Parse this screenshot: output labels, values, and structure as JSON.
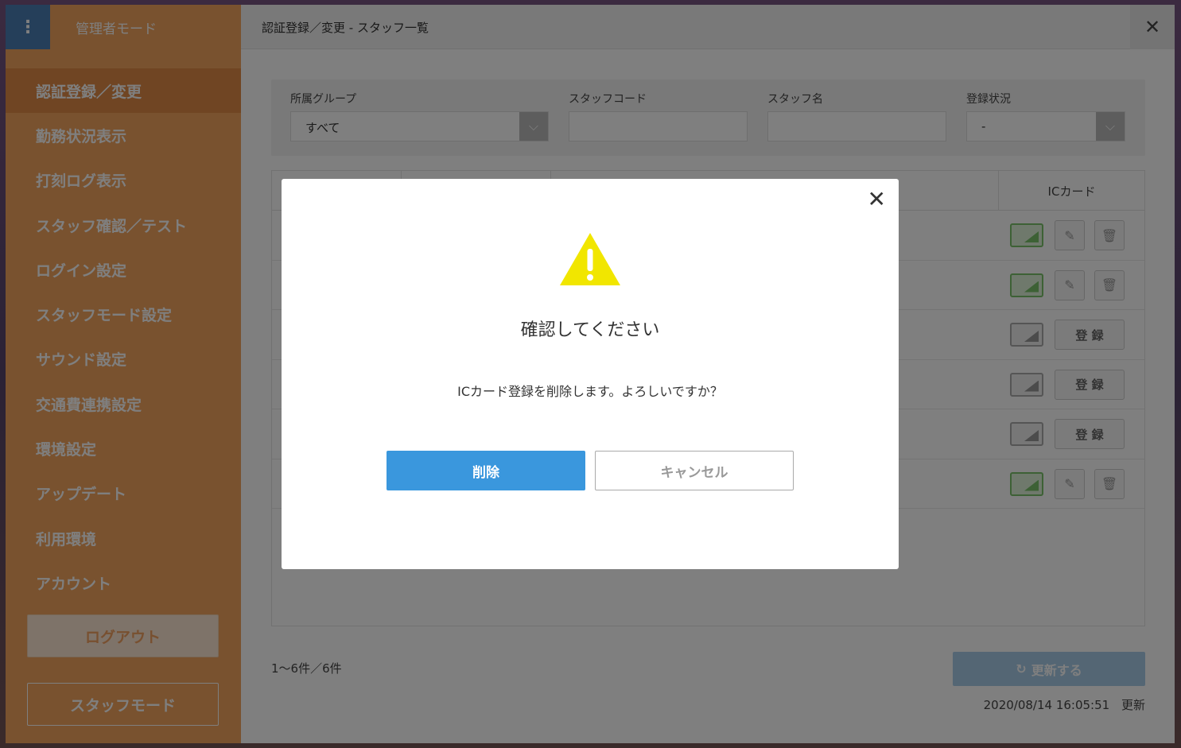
{
  "sidebar": {
    "menu_icon": "kebab-menu-icon",
    "title": "管理者モード",
    "items": [
      {
        "label": "認証登録／変更",
        "active": true
      },
      {
        "label": "勤務状況表示"
      },
      {
        "label": "打刻ログ表示"
      },
      {
        "label": "スタッフ確認／テスト"
      },
      {
        "label": "ログイン設定"
      },
      {
        "label": "スタッフモード設定"
      },
      {
        "label": "サウンド設定"
      },
      {
        "label": "交通費連携設定"
      },
      {
        "label": "環境設定"
      },
      {
        "label": "アップデート"
      },
      {
        "label": "利用環境"
      },
      {
        "label": "アカウント"
      }
    ],
    "logout_label": "ログアウト",
    "staffmode_label": "スタッフモード"
  },
  "header": {
    "title": "認証登録／変更 - スタッフ一覧",
    "close_icon": "close-icon"
  },
  "filters": {
    "group": {
      "label": "所属グループ",
      "value": "すべて"
    },
    "staff_code": {
      "label": "スタッフコード",
      "value": ""
    },
    "staff_name": {
      "label": "スタッフ名",
      "value": ""
    },
    "status": {
      "label": "登録状況",
      "value": "-"
    }
  },
  "table": {
    "ic_header": "ICカード",
    "register_label": "登 録",
    "rows": [
      {
        "ic": "registered"
      },
      {
        "ic": "registered"
      },
      {
        "ic": "unregistered"
      },
      {
        "ic": "unregistered"
      },
      {
        "ic": "unregistered"
      },
      {
        "ic": "registered"
      }
    ]
  },
  "footer": {
    "pager": "1〜6件／6件",
    "refresh_label": "更新する",
    "updated_at": "2020/08/14 16:05:51",
    "updated_suffix": "更新"
  },
  "modal": {
    "title": "確認してください",
    "message": "ICカード登録を削除します。よろしいですか？",
    "delete_label": "削除",
    "cancel_label": "キャンセル",
    "warning_color": "#f1e600",
    "primary_color": "#3a97dd"
  }
}
